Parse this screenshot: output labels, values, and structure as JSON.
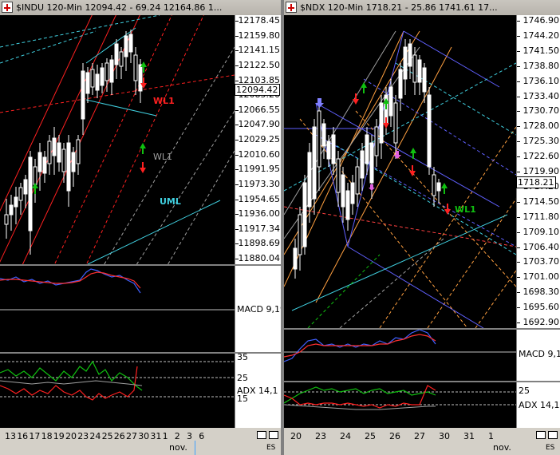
{
  "left": {
    "title": "$INDU 120-Min  12094.42  - 69.24  12164.86  1...",
    "price_ticks": [
      "12178.45",
      "12159.80",
      "12141.15",
      "12122.50",
      "12103.85",
      "12085.20",
      "12066.55",
      "12047.90",
      "12029.25",
      "12010.60",
      "11991.95",
      "11973.30",
      "11954.65",
      "11936.00",
      "11917.34",
      "11898.69",
      "11880.04"
    ],
    "last_price": "12094.42",
    "macd_label": "MACD 9,19",
    "adx_label": "ADX 14,1",
    "adx_ticks": [
      "35",
      "25",
      "15"
    ],
    "dates": [
      "13",
      "16",
      "17",
      "18",
      "19",
      "20",
      "23",
      "24",
      "25",
      "26",
      "27",
      "30",
      "31",
      "1",
      "2",
      "3",
      "6"
    ],
    "month": "nov.",
    "labels": {
      "wl1_red": "WL1",
      "wl1_gray": "WL1",
      "uml": "UML"
    },
    "es": "ES",
    "colors": {
      "red": "#ff2020",
      "cyan": "#40d0e0",
      "gray": "#a0a0a0",
      "green": "#10c010"
    }
  },
  "right": {
    "title": "$NDX 120-Min  1718.21  - 25.86  1741.61  17...",
    "price_ticks": [
      "1746.90",
      "1744.20",
      "1741.50",
      "1738.80",
      "1736.10",
      "1733.40",
      "1730.70",
      "1728.00",
      "1725.30",
      "1722.60",
      "1719.90",
      "1717.20",
      "1714.50",
      "1711.80",
      "1709.10",
      "1706.40",
      "1703.70",
      "1701.00",
      "1698.30",
      "1695.60",
      "1692.90"
    ],
    "last_price": "1718.21",
    "macd_label": "MACD 9,1",
    "adx_label": "ADX 14,1",
    "adx_ticks": [
      "25"
    ],
    "dates": [
      "20",
      "23",
      "24",
      "25",
      "26",
      "27",
      "30",
      "31",
      "1"
    ],
    "month": "nov.",
    "labels": {
      "wl1": "WL1"
    },
    "es": "ES"
  }
}
